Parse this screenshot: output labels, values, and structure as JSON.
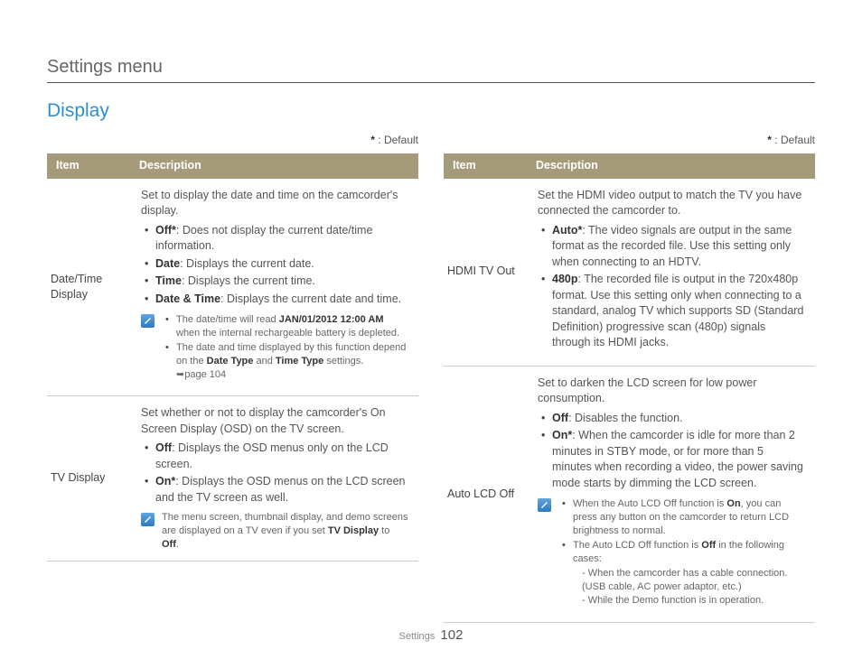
{
  "page_title": "Settings menu",
  "section_title": "Display",
  "default_note_star": "*",
  "default_note_text": " : Default",
  "headers": {
    "item": "Item",
    "description": "Description"
  },
  "left": {
    "row1": {
      "item": "Date/Time Display",
      "intro": "Set to display the date and time on the camcorder's display.",
      "b1_label": "Off*",
      "b1_text": ": Does not display the current date/time information.",
      "b2_label": "Date",
      "b2_text": ": Displays the current date.",
      "b3_label": "Time",
      "b3_text": ": Displays the current time.",
      "b4_label": "Date & Time",
      "b4_text": ": Displays the current date and time.",
      "note1_a": "The date/time will read ",
      "note1_b": "JAN/01/2012 12:00 AM",
      "note1_c": " when the internal rechargeable battery is depleted.",
      "note2_a": "The date and time displayed by this function depend on the ",
      "note2_b": "Date Type",
      "note2_c": " and ",
      "note2_d": "Time Type",
      "note2_e": " settings.",
      "note_page": "➥page 104"
    },
    "row2": {
      "item": "TV Display",
      "intro": "Set whether or not to display the camcorder's On Screen Display (OSD) on the TV screen.",
      "b1_label": "Off",
      "b1_text": ": Displays the OSD menus only on the LCD screen.",
      "b2_label": "On*",
      "b2_text": ": Displays the OSD menus on the LCD screen and the TV screen as well.",
      "note_a": "The menu screen, thumbnail display, and demo screens are displayed on a TV even if you set ",
      "note_b": "TV Display",
      "note_c": " to ",
      "note_d": "Off",
      "note_e": "."
    }
  },
  "right": {
    "row1": {
      "item": "HDMI TV Out",
      "intro": "Set the HDMI video output to match the TV you have connected the camcorder to.",
      "b1_label": "Auto*",
      "b1_text": ": The video signals are output in the same format as the recorded file. Use this setting only when connecting to an HDTV.",
      "b2_label": "480p",
      "b2_text": ": The recorded file is output in the 720x480p format. Use this setting only when connecting to a standard, analog TV which supports SD (Standard Definition) progressive scan (480p) signals through its HDMI jacks."
    },
    "row2": {
      "item": "Auto LCD Off",
      "intro": "Set to darken the LCD screen for low power consumption.",
      "b1_label": "Off",
      "b1_text": ": Disables the function.",
      "b2_label": "On*",
      "b2_text": ": When the camcorder is idle for more than 2 minutes in STBY mode, or for more than 5 minutes when recording a video, the power saving mode starts by dimming the LCD screen.",
      "note1_a": "When the Auto LCD Off function is ",
      "note1_b": "On",
      "note1_c": ", you can press any button on the camcorder to return LCD brightness to normal.",
      "note2_a": "The Auto LCD Off function is ",
      "note2_b": "Off",
      "note2_c": " in the following cases:",
      "sub1": "When the camcorder has a cable connection. (USB cable, AC power adaptor, etc.)",
      "sub2": "While the Demo function is in operation."
    }
  },
  "footer_section": "Settings",
  "footer_page": "102"
}
